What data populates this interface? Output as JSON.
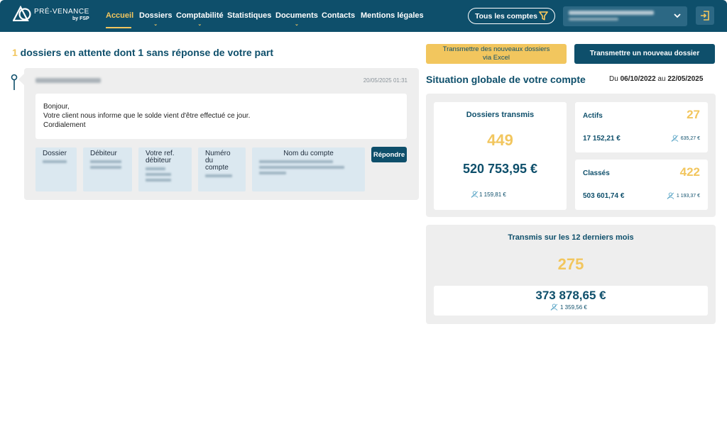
{
  "brand": {
    "name": "PRÉ-VENANCE",
    "sub": "by FSP"
  },
  "nav": [
    {
      "label": "Accueil",
      "active": true
    },
    {
      "label": "Dossiers",
      "dropdown": true
    },
    {
      "label": "Comptabilité",
      "dropdown": true
    },
    {
      "label": "Statistiques"
    },
    {
      "label": "Documents",
      "dropdown": true
    },
    {
      "label": "Contacts"
    },
    {
      "label": "Mentions légales"
    }
  ],
  "filter": {
    "label": "Tous les comptes",
    "icon": "filter-icon"
  },
  "colors": {
    "primary": "#0e4f6b",
    "accent": "#f2c65e",
    "panel": "#eeeeee",
    "info": "#dbe8f0"
  },
  "pending": {
    "count": "1",
    "text": " dossiers en attente dont 1 sans réponse de votre part"
  },
  "message": {
    "date": "20/05/2025 01:31",
    "greeting": "Bonjour,",
    "body": "Votre client nous informe que le solde vient d'être effectué ce jour.",
    "closing": "Cordialement",
    "fields": {
      "dossier": "Dossier",
      "debiteur": "Débiteur",
      "ref_line1": "Votre ref.",
      "ref_line2": "débiteur",
      "numero_line1": "Numéro",
      "numero_line2": "du",
      "numero_line3": "compte",
      "nom_compte": "Nom du compte"
    },
    "reply_label": "Répondre"
  },
  "actions": {
    "excel_line1": "Transmettre des nouveaux dossiers",
    "excel_line2": "via Excel",
    "new_label": "Transmettre un nouveau dossier"
  },
  "situation": {
    "title": "Situation globale de votre compte",
    "period_from_label": "Du",
    "period_from": "06/10/2022",
    "period_to_label": "au",
    "period_to": "22/05/2025"
  },
  "stats": {
    "transmis": {
      "title": "Dossiers transmis",
      "count": "449",
      "amount": "520 753,95 €",
      "average": "1 159,81 €"
    },
    "actifs": {
      "title": "Actifs",
      "count": "27",
      "amount": "17 152,21 €",
      "average": "635,27 €"
    },
    "classes": {
      "title": "Classés",
      "count": "422",
      "amount": "503 601,74 €",
      "average": "1 193,37 €"
    },
    "last12": {
      "title": "Transmis sur les 12 derniers mois",
      "count": "275",
      "amount": "373 878,65 €",
      "average": "1 359,56 €"
    }
  }
}
